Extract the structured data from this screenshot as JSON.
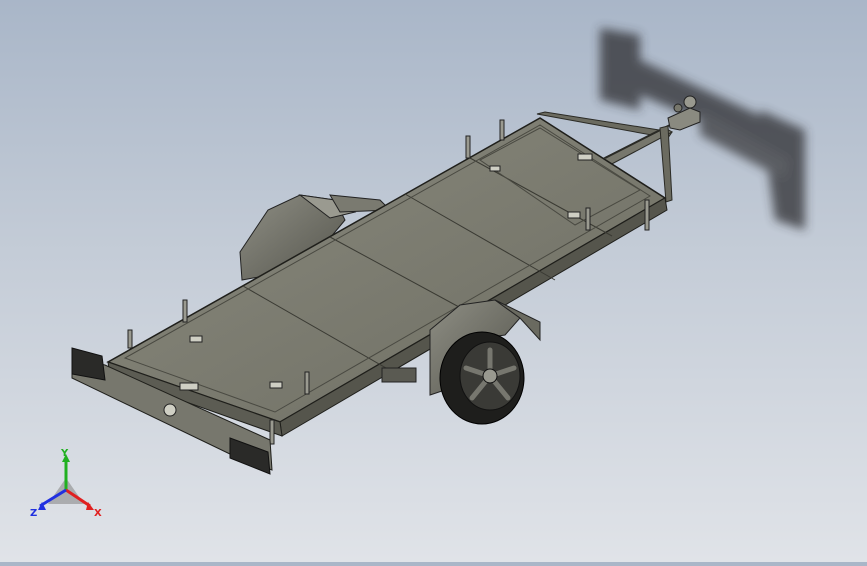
{
  "viewport": {
    "background_top": "#a9b6c8",
    "background_bottom": "#e0e3e8",
    "model_description_icon": "trailer-assembly"
  },
  "triad": {
    "x_label": "X",
    "y_label": "Y",
    "z_label": "Z",
    "x_color": "#e02020",
    "y_color": "#20b020",
    "z_color": "#2030e0"
  }
}
